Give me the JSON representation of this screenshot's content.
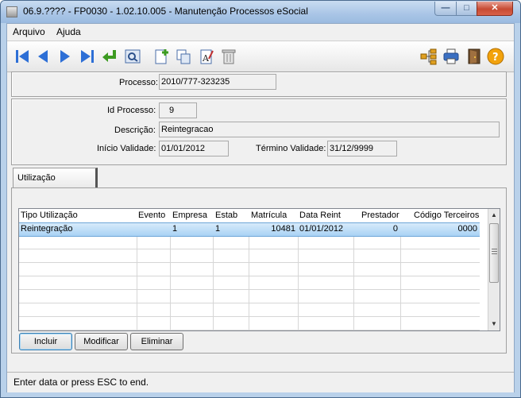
{
  "window": {
    "title": "06.9.???? - FP0030 - 1.02.10.005 - Manutenção Processos eSocial"
  },
  "menu": [
    {
      "label": "Arquivo"
    },
    {
      "label": "Ajuda"
    }
  ],
  "toolbar": {
    "icons": [
      "first-icon",
      "previous-icon",
      "next-icon",
      "last-icon",
      "return-icon",
      "search-icon",
      "new-icon",
      "copy-icon",
      "edit-icon",
      "delete-icon",
      "tree-icon",
      "print-icon",
      "exit-icon",
      "help-icon"
    ]
  },
  "processo": {
    "label": "Processo:",
    "value": "2010/777-323235"
  },
  "details": {
    "id_label": "Id Processo:",
    "id_value": "9",
    "descricao_label": "Descrição:",
    "descricao_value": "Reintegracao",
    "inicio_label": "Início Validade:",
    "inicio_value": "01/01/2012",
    "termino_label": "Término Validade:",
    "termino_value": "31/12/9999"
  },
  "tab": {
    "label": "Utilização"
  },
  "grid": {
    "columns": [
      "Tipo Utilização",
      "Evento",
      "Empresa",
      "Estab",
      "Matrícula",
      "Data Reint",
      "Prestador",
      "Código Terceiros"
    ],
    "rows": [
      {
        "tipo": "Reintegração",
        "evento": "",
        "empresa": "1",
        "estab": "1",
        "matricula": "10481",
        "data_reint": "01/01/2012",
        "prestador": "0",
        "codigo_terceiros": "0000"
      }
    ]
  },
  "buttons": {
    "incluir": "Incluir",
    "modificar": "Modificar",
    "eliminar": "Eliminar"
  },
  "status": {
    "text": "Enter data or press ESC to end."
  },
  "colors": {
    "title_bar": "#a9c5e6",
    "selection": "#a9d2f4",
    "nav_blue": "#2d6fd6",
    "accent_green": "#3d9b22"
  }
}
